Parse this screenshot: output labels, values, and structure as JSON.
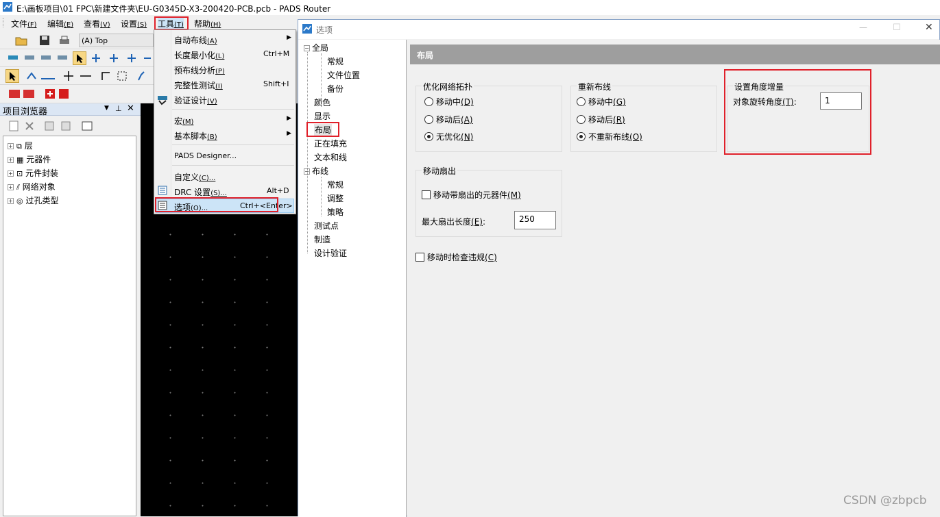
{
  "app": {
    "title": "E:\\画板项目\\01 FPC\\新建文件夹\\EU-G0345D-X3-200420-PCB.pcb - PADS Router"
  },
  "menubar": {
    "items": [
      {
        "label": "文件",
        "key": "(F)"
      },
      {
        "label": "编辑",
        "key": "(E)"
      },
      {
        "label": "查看",
        "key": "(V)"
      },
      {
        "label": "设置",
        "key": "(S)"
      },
      {
        "label": "工具",
        "key": "(T)"
      },
      {
        "label": "帮助",
        "key": "(H)"
      }
    ]
  },
  "toolbar": {
    "layer_select": "(A) Top"
  },
  "tools_menu": {
    "items": [
      {
        "label": "自动布线",
        "key": "(A)",
        "shortcut": "",
        "submenu": true
      },
      {
        "label": "长度最小化",
        "key": "(L)",
        "shortcut": "Ctrl+M",
        "submenu": false
      },
      {
        "label": "预布线分析",
        "key": "(P)",
        "shortcut": "",
        "submenu": false
      },
      {
        "label": "完整性测试",
        "key": "(I)",
        "shortcut": "Shift+I",
        "submenu": false
      },
      {
        "label": "验证设计",
        "key": "(V)",
        "shortcut": "",
        "submenu": false
      },
      {
        "label": "宏",
        "key": "(M)",
        "shortcut": "",
        "submenu": true
      },
      {
        "label": "基本脚本",
        "key": "(B)",
        "shortcut": "",
        "submenu": true
      },
      {
        "label": "PADS Designer...",
        "key": "",
        "shortcut": "",
        "submenu": false
      },
      {
        "label": "自定义",
        "key": "(C)...",
        "shortcut": "",
        "submenu": false
      },
      {
        "label": "DRC 设置",
        "key": "(S)...",
        "shortcut": "Alt+D",
        "submenu": false
      },
      {
        "label": "选项",
        "key": "(O)...",
        "shortcut": "Ctrl+<Enter>",
        "submenu": false
      }
    ]
  },
  "project_browser": {
    "title": "项目浏览器",
    "items": [
      "层",
      "元器件",
      "元件封装",
      "网络对象",
      "过孔类型"
    ]
  },
  "dialog": {
    "title": "选项",
    "tree": [
      {
        "label": "全局",
        "level": 0,
        "expand": true
      },
      {
        "label": "常规",
        "level": 1
      },
      {
        "label": "文件位置",
        "level": 1
      },
      {
        "label": "备份",
        "level": 1
      },
      {
        "label": "颜色",
        "level": 0
      },
      {
        "label": "显示",
        "level": 0
      },
      {
        "label": "布局",
        "level": 0
      },
      {
        "label": "正在填充",
        "level": 0
      },
      {
        "label": "文本和线",
        "level": 0
      },
      {
        "label": "布线",
        "level": 0,
        "expand": true
      },
      {
        "label": "常规",
        "level": 1
      },
      {
        "label": "调整",
        "level": 1
      },
      {
        "label": "策略",
        "level": 1
      },
      {
        "label": "测试点",
        "level": 0
      },
      {
        "label": "制造",
        "level": 0
      },
      {
        "label": "设计验证",
        "level": 0
      }
    ],
    "panel_title": "布局",
    "optimize": {
      "title": "优化网络拓扑",
      "options": [
        {
          "label": "移动中",
          "key": "(D)",
          "checked": false
        },
        {
          "label": "移动后",
          "key": "(A)",
          "checked": false
        },
        {
          "label": "无优化",
          "key": "(N)",
          "checked": true
        }
      ]
    },
    "reroute": {
      "title": "重新布线",
      "options": [
        {
          "label": "移动中",
          "key": "(G)",
          "checked": false
        },
        {
          "label": "移动后",
          "key": "(R)",
          "checked": false
        },
        {
          "label": "不重新布线",
          "key": "(O)",
          "checked": true
        }
      ]
    },
    "angle": {
      "title": "设置角度增量",
      "label": "对象旋转角度",
      "key": "(T)",
      "value": "1"
    },
    "fanout": {
      "title": "移动扇出",
      "move_label": "移动带扇出的元器件",
      "move_key": "(M)",
      "move_checked": false,
      "length_label": "最大扇出长度",
      "length_key": "(E)",
      "length_value": "250"
    },
    "check_label": "移动时检查违规",
    "check_key": "(C)",
    "check_checked": false
  },
  "watermark": "CSDN @zbpcb",
  "colors": {
    "highlight": "#e0202a",
    "panel_header": "#9e9e9e"
  }
}
